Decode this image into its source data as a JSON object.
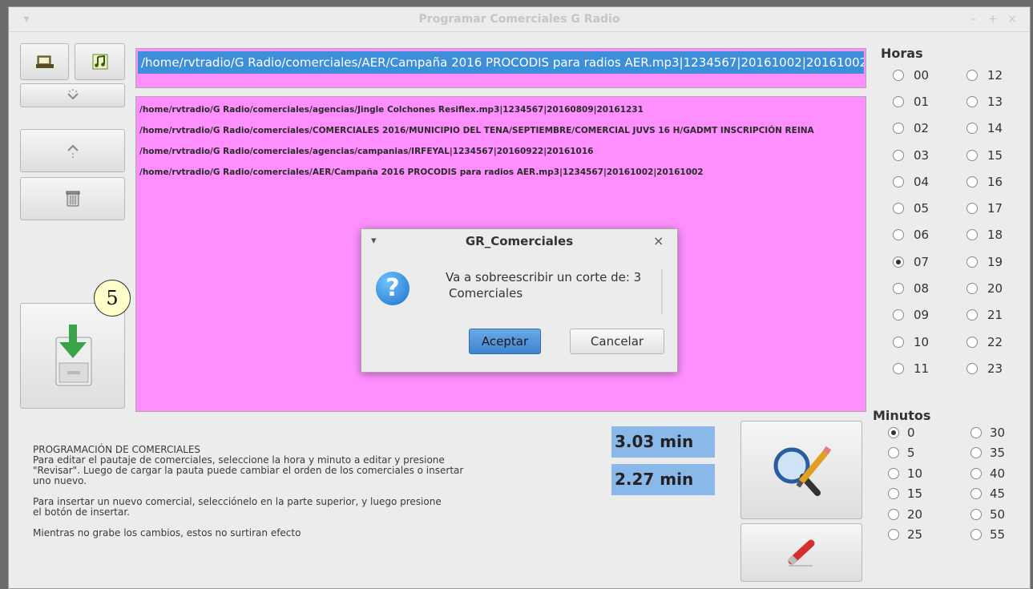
{
  "window": {
    "title": "Programar Comerciales G Radio",
    "menu_glyph": "▾",
    "minimize_glyph": "–",
    "maximize_glyph": "+",
    "close_glyph": "×"
  },
  "selected_path": "/home/rvtradio/G Radio/comerciales/AER/Campaña 2016 PROCODIS para radios AER.mp3|1234567|20161002|20161002",
  "commercials": [
    "/home/rvtradio/G Radio/comerciales/agencias/Jingle Colchones Resiflex.mp3|1234567|20160809|20161231",
    "/home/rvtradio/G Radio/comerciales/COMERCIALES 2016/MUNICIPIO DEL TENA/SEPTIEMBRE/COMERCIAL  JUVS 16 H/GADMT INSCRIPCIÓN REINA",
    "/home/rvtradio/G Radio/comerciales/agencias/campanias/IRFEYAL|1234567|20160922|20161016",
    "/home/rvtradio/G Radio/comerciales/AER/Campaña 2016 PROCODIS para radios AER.mp3|1234567|20161002|20161002"
  ],
  "hours": {
    "label": "Horas",
    "left": [
      "00",
      "01",
      "02",
      "03",
      "04",
      "05",
      "06",
      "07",
      "08",
      "09",
      "10",
      "11"
    ],
    "right": [
      "12",
      "13",
      "14",
      "15",
      "16",
      "17",
      "18",
      "19",
      "20",
      "21",
      "22",
      "23"
    ],
    "selected": "07"
  },
  "minutes": {
    "label": "Minutos",
    "left": [
      "0",
      "5",
      "10",
      "15",
      "20",
      "25"
    ],
    "right": [
      "30",
      "35",
      "40",
      "45",
      "50",
      "55"
    ],
    "selected": "0"
  },
  "badge": "5",
  "info": {
    "title": "PROGRAMACIÓN DE COMERCIALES",
    "line1": "Para editar el pautaje de comerciales, seleccione la hora y minuto a editar y presione",
    "line2": "\"Revisar\". Luego de cargar la pauta puede cambiar el orden de los comerciales o insertar",
    "line3": "uno nuevo.",
    "line4": "Para insertar un nuevo comercial, selecciónelo en la parte superior, y luego presione",
    "line5": "el botón de insertar.",
    "line6": "Mientras no grabe los cambios, estos no surtiran efecto"
  },
  "durations": {
    "first": "3.03 min",
    "second": "2.27 min"
  },
  "dialog": {
    "title": "GR_Comerciales",
    "menu_glyph": "▾",
    "close_glyph": "×",
    "icon_glyph": "?",
    "message_line1": "Va a sobreescribir un corte de: 3",
    "message_line2": "Comerciales",
    "accept": "Aceptar",
    "cancel": "Cancelar"
  },
  "colors": {
    "pink_list": "#ff8fff",
    "selection": "#3c8fd8",
    "meter": "#8ab8e8",
    "accept_button": "#4a90d9"
  }
}
